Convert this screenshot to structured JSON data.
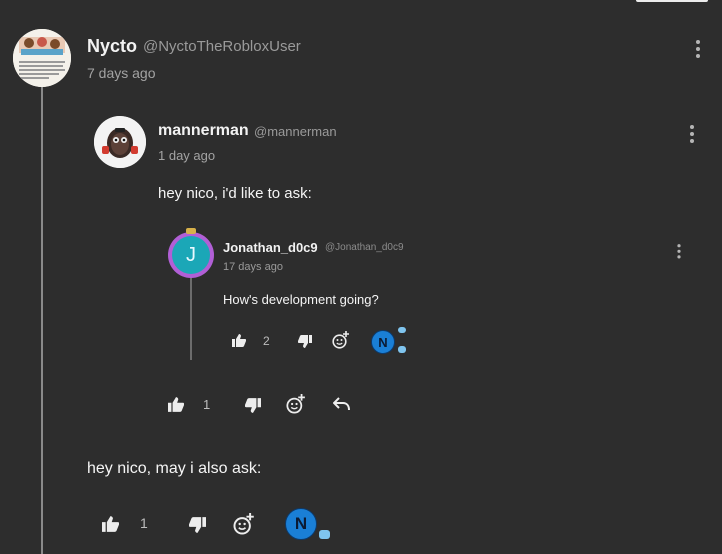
{
  "top_comment": {
    "author": "Nycto",
    "handle": "@NyctoTheRobloxUser",
    "time": "7 days ago",
    "text": "hey nico, may i also ask:",
    "likes": "1"
  },
  "reply_1": {
    "author": "mannerman",
    "handle": "@mannerman",
    "time": "1 day ago",
    "text": "hey nico, i'd like to ask:",
    "likes": "1"
  },
  "reply_2": {
    "author": "Jonathan_d0c9",
    "handle": "@Jonathan_d0c9",
    "time": "17 days ago",
    "text": "How's development going?",
    "likes": "2",
    "avatar_letter": "J"
  },
  "icons": {
    "like": "thumbs-up-icon",
    "dislike": "thumbs-down-icon",
    "react": "add-reaction-icon",
    "reply": "reply-icon",
    "more": "more-options-icon"
  },
  "colors": {
    "background": "#2d2d2d",
    "avatar_ring": "#b15fd6",
    "avatar_fill": "#1ba7b7",
    "badge": "#1a7fd6"
  }
}
